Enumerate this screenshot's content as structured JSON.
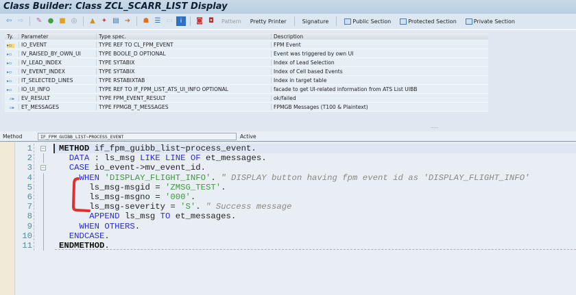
{
  "window": {
    "title": "Class Builder: Class ZCL_SCARR_LIST Display"
  },
  "toolbar": {
    "icons": [
      "back-icon",
      "forward-icon",
      "other-object-icon",
      "display-change-icon",
      "active-inactive-icon",
      "where-used-icon",
      "check-icon",
      "activate-icon",
      "test-icon",
      "navigate-icon",
      "hierarchy-icon",
      "constructor-icon",
      "blank-icon",
      "info-icon",
      "breakpoint-icon",
      "session-breakpoint-icon"
    ],
    "pattern": "Pattern",
    "pretty_printer": "Pretty Printer",
    "signature": "Signature",
    "public_section": "Public Section",
    "protected_section": "Protected Section",
    "private_section": "Private Section"
  },
  "params": {
    "headers": [
      "Ty.",
      "Parameter",
      "Type spec.",
      "Description"
    ],
    "rows": [
      {
        "ty": "importing",
        "name": "IO_EVENT",
        "type": "TYPE REF TO CL_FPM_EVENT",
        "desc": "FPM Event",
        "selected": true
      },
      {
        "ty": "importing",
        "name": "IV_RAISED_BY_OWN_UI",
        "type": "TYPE BOOLE_D OPTIONAL",
        "desc": "Event was triggered by own UI"
      },
      {
        "ty": "importing",
        "name": "IV_LEAD_INDEX",
        "type": "TYPE SYTABIX",
        "desc": "Index of Lead Selection"
      },
      {
        "ty": "importing",
        "name": "IV_EVENT_INDEX",
        "type": "TYPE SYTABIX",
        "desc": "Index of Cell based Events"
      },
      {
        "ty": "importing",
        "name": "IT_SELECTED_LINES",
        "type": "TYPE RSTABIXTAB",
        "desc": "Index in target table"
      },
      {
        "ty": "importing",
        "name": "IO_UI_INFO",
        "type": "TYPE REF TO IF_FPM_LIST_ATS_UI_INFO OPTIONAL",
        "desc": "facade to get UI-related information from ATS List UIBB"
      },
      {
        "ty": "exporting",
        "name": "EV_RESULT",
        "type": "TYPE FPM_EVENT_RESULT",
        "desc": "ok/failed"
      },
      {
        "ty": "exporting",
        "name": "ET_MESSAGES",
        "type": "TYPE FPMGB_T_MESSAGES",
        "desc": "FPMGB Messages (T100 & Plaintext)"
      }
    ]
  },
  "method_bar": {
    "label": "Method",
    "value": "IF_FPM_GUIBB_LIST~PROCESS_EVENT",
    "status": "Active"
  },
  "editor": {
    "line_numbers": [
      "1",
      "2",
      "3",
      "4",
      "5",
      "6",
      "7",
      "8",
      "9",
      "10",
      "11"
    ],
    "lines": [
      [
        {
          "t": "METHOD",
          "c": "kwb"
        },
        {
          "t": " if_fpm_guibb_list~process_event.",
          "c": "pl"
        }
      ],
      [
        {
          "t": "  "
        },
        {
          "t": "DATA",
          "c": "kw"
        },
        {
          "t": " : ls_msg ",
          "c": "pl"
        },
        {
          "t": "LIKE LINE OF",
          "c": "kw"
        },
        {
          "t": " et_messages.",
          "c": "pl"
        }
      ],
      [
        {
          "t": "  "
        },
        {
          "t": "CASE",
          "c": "kw"
        },
        {
          "t": " io_event->mv_event_id.",
          "c": "pl"
        }
      ],
      [
        {
          "t": "    "
        },
        {
          "t": "WHEN",
          "c": "kw"
        },
        {
          "t": " ",
          "c": "pl"
        },
        {
          "t": "'DISPLAY_FLIGHT_INFO'",
          "c": "str"
        },
        {
          "t": ". ",
          "c": "pl"
        },
        {
          "t": "\" DISPLAY button having fpm event id as 'DISPLAY_FLIGHT_INFO'",
          "c": "cmt"
        }
      ],
      [
        {
          "t": "      ls_msg-msgid = ",
          "c": "pl"
        },
        {
          "t": "'ZMSG_TEST'",
          "c": "str"
        },
        {
          "t": ".",
          "c": "pl"
        }
      ],
      [
        {
          "t": "      ls_msg-msgno = ",
          "c": "pl"
        },
        {
          "t": "'000'",
          "c": "str"
        },
        {
          "t": ".",
          "c": "pl"
        }
      ],
      [
        {
          "t": "      ls_msg-severity = ",
          "c": "pl"
        },
        {
          "t": "'S'",
          "c": "str"
        },
        {
          "t": ". ",
          "c": "pl"
        },
        {
          "t": "\" Success message",
          "c": "cmt"
        }
      ],
      [
        {
          "t": "      "
        },
        {
          "t": "APPEND",
          "c": "kw"
        },
        {
          "t": " ls_msg ",
          "c": "pl"
        },
        {
          "t": "TO",
          "c": "kw"
        },
        {
          "t": " et_messages.",
          "c": "pl"
        }
      ],
      [
        {
          "t": "    "
        },
        {
          "t": "WHEN OTHERS",
          "c": "kw"
        },
        {
          "t": ".",
          "c": "pl"
        }
      ],
      [
        {
          "t": "  "
        },
        {
          "t": "ENDCASE",
          "c": "kw"
        },
        {
          "t": ".",
          "c": "pl"
        }
      ],
      [
        {
          "t": "ENDMETHOD",
          "c": "kwb"
        },
        {
          "t": ".",
          "c": "pl"
        }
      ]
    ],
    "annotation_color": "#e03030"
  }
}
